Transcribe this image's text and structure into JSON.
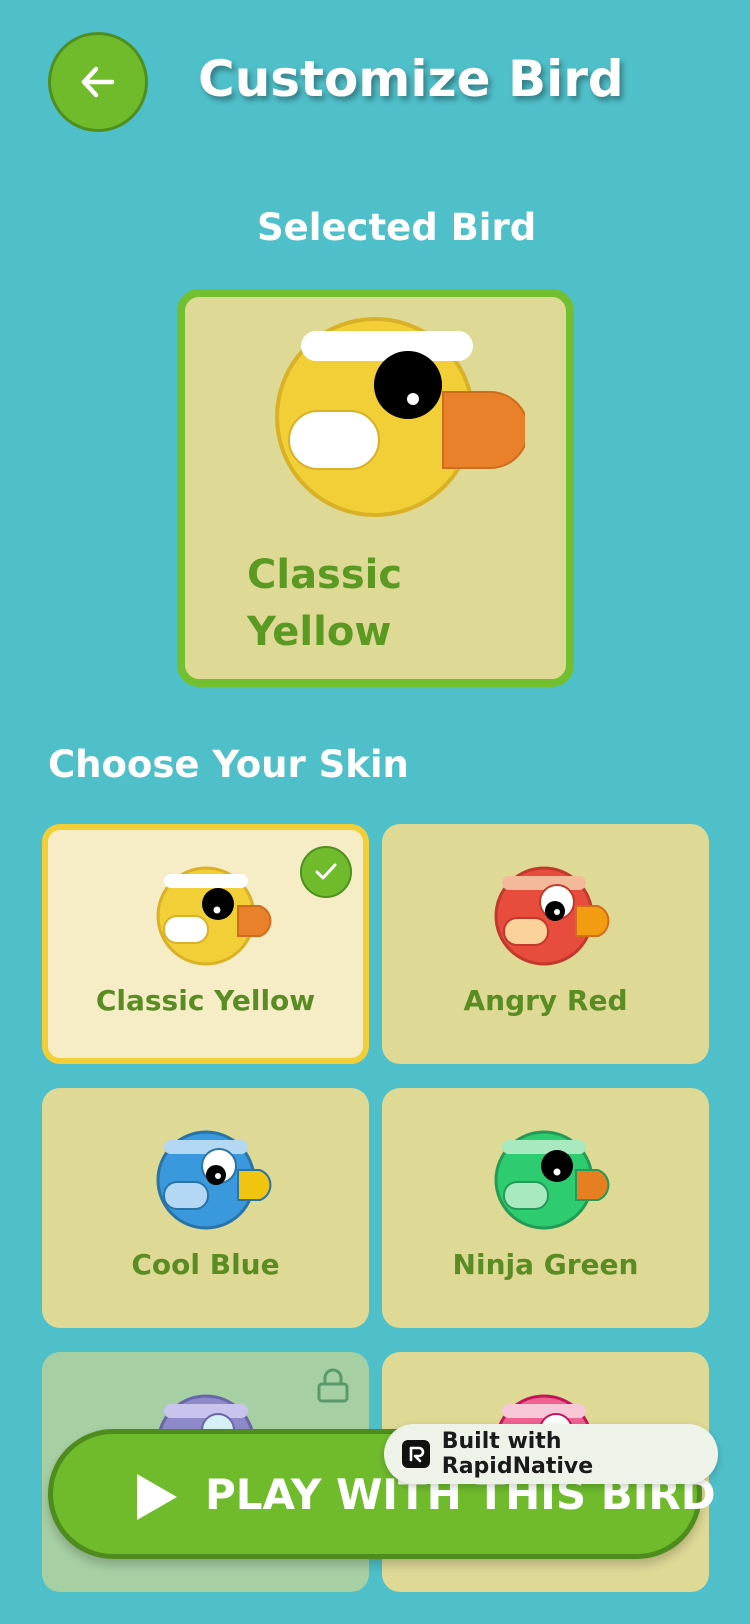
{
  "header": {
    "title": "Customize Bird",
    "back_icon": "arrow-left-icon"
  },
  "selected_section": {
    "label": "Selected Bird",
    "bird_name": "Classic Yellow"
  },
  "skins_section": {
    "label": "Choose Your Skin"
  },
  "skins": [
    {
      "name": "Classic Yellow",
      "selected": true,
      "locked": false,
      "body": "#f2cf36",
      "beak": "#e8812a",
      "wing": "#ffffff",
      "band": "#ffffff"
    },
    {
      "name": "Angry Red",
      "selected": false,
      "locked": false,
      "body": "#e74c3c",
      "beak": "#f39c12",
      "wing": "#fbd39a",
      "band": "#f4b99a"
    },
    {
      "name": "Cool Blue",
      "selected": false,
      "locked": false,
      "body": "#3a98dc",
      "beak": "#f1c40f",
      "wing": "#b4d8f3",
      "band": "#b4d8f3"
    },
    {
      "name": "Ninja Green",
      "selected": false,
      "locked": false,
      "body": "#2ecc71",
      "beak": "#e67e22",
      "wing": "#a8e9c0",
      "band": "#a8e9c0"
    },
    {
      "name": "",
      "selected": false,
      "locked": true,
      "body": "#8e89c9",
      "beak": "#e8812a",
      "wing": "#cfcaf0",
      "band": "#c9c4ee"
    },
    {
      "name": "",
      "selected": false,
      "locked": false,
      "body": "#f06292",
      "beak": "#e8812a",
      "wing": "#f8bbd0",
      "band": "#f8c8d8"
    }
  ],
  "play_button": {
    "label": "PLAY WITH THIS BIRD",
    "icon": "play-icon"
  },
  "badge": {
    "label": "Built with RapidNative",
    "icon": "rapidnative-logo-icon"
  },
  "colors": {
    "background": "#4fc0ca",
    "accent": "#6fbb2c",
    "card": "#dfd996",
    "selected_border": "#f2cf36"
  }
}
